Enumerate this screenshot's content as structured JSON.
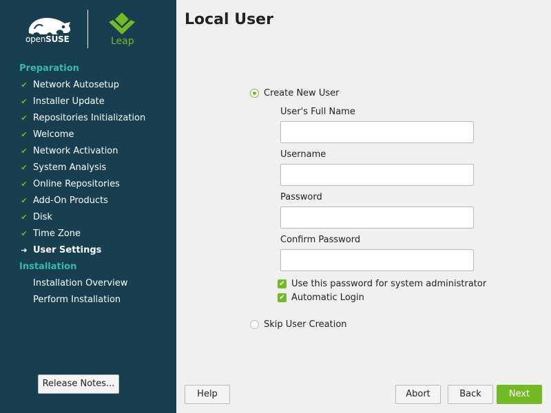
{
  "branding": {
    "opensuse_prefix": "open",
    "opensuse_suffix": "SUSE",
    "leap_label": "Leap"
  },
  "sidebar": {
    "sections": [
      {
        "label": "Preparation",
        "steps": [
          {
            "label": "Network Autosetup",
            "state": "done"
          },
          {
            "label": "Installer Update",
            "state": "done"
          },
          {
            "label": "Repositories Initialization",
            "state": "done"
          },
          {
            "label": "Welcome",
            "state": "done"
          },
          {
            "label": "Network Activation",
            "state": "done"
          },
          {
            "label": "System Analysis",
            "state": "done"
          },
          {
            "label": "Online Repositories",
            "state": "done"
          },
          {
            "label": "Add-On Products",
            "state": "done"
          },
          {
            "label": "Disk",
            "state": "done"
          },
          {
            "label": "Time Zone",
            "state": "done"
          },
          {
            "label": "User Settings",
            "state": "current"
          }
        ]
      },
      {
        "label": "Installation",
        "steps": [
          {
            "label": "Installation Overview",
            "state": "pending"
          },
          {
            "label": "Perform Installation",
            "state": "pending"
          }
        ]
      }
    ],
    "release_notes_label": "Release Notes..."
  },
  "main": {
    "title": "Local User",
    "create_user_option": {
      "label": "Create New User",
      "selected": true
    },
    "fields": [
      {
        "label": "User's Full Name",
        "value": ""
      },
      {
        "label": "Username",
        "value": ""
      },
      {
        "label": "Password",
        "value": ""
      },
      {
        "label": "Confirm Password",
        "value": ""
      }
    ],
    "checkboxes": [
      {
        "label": "Use this password for system administrator",
        "checked": true
      },
      {
        "label": "Automatic Login",
        "checked": true
      }
    ],
    "skip_user_option": {
      "label": "Skip User Creation",
      "selected": false
    }
  },
  "buttons": {
    "help": "Help",
    "abort": "Abort",
    "back": "Back",
    "next": "Next"
  },
  "colors": {
    "sidebar_bg": "#173f4f",
    "section_heading": "#35b9ab",
    "accent_green": "#73ba25"
  }
}
